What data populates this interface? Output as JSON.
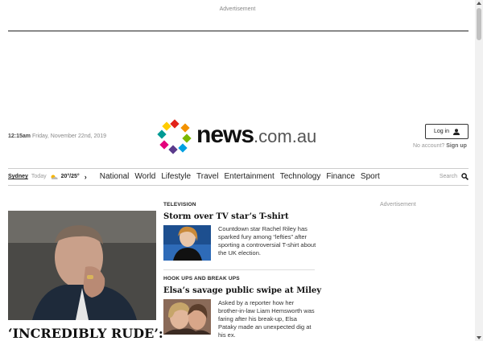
{
  "ad": {
    "top_label": "Advertisement",
    "side_label": "Advertisement"
  },
  "header": {
    "time": "12:15am",
    "date": "Friday, November 22nd, 2019",
    "logo_main": "news",
    "logo_suffix": ".com.au",
    "login_label": "Log in",
    "no_account_text": "No account?",
    "signup_label": "Sign up"
  },
  "nav": {
    "city": "Sydney",
    "today": "Today",
    "temps": "20°/25°",
    "items": [
      "National",
      "World",
      "Lifestyle",
      "Travel",
      "Entertainment",
      "Technology",
      "Finance",
      "Sport"
    ],
    "search_label": "Search"
  },
  "hero": {
    "headline": "‘INCREDIBLY RUDE’:"
  },
  "stories": [
    {
      "kicker": "TELEVISION",
      "title": "Storm over TV star’s T-shirt",
      "blurb": "Countdown star Rachel Riley has sparked fury among “lefties” after sporting a controversial T-shirt about the UK election."
    },
    {
      "kicker": "HOOK UPS AND BREAK UPS",
      "title": "Elsa’s savage public swipe at Miley",
      "blurb": "Asked by a reporter how her brother-in-law Liam Hemsworth was faring after his break-up, Elsa Pataky made an unexpected dig at his ex."
    }
  ],
  "colors": {
    "logo_dots": [
      "#e2231a",
      "#f39200",
      "#7ab800",
      "#00a0e1",
      "#5b3b8c",
      "#e4007c",
      "#009a93",
      "#ffcc00"
    ]
  }
}
